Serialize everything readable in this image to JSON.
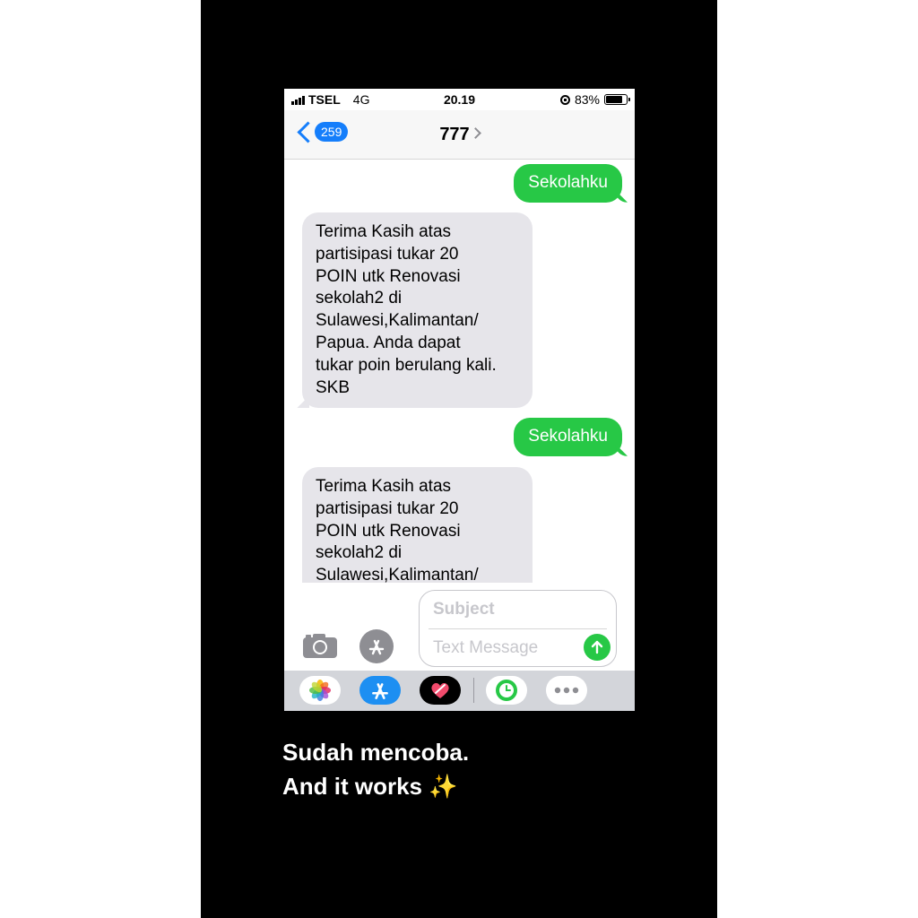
{
  "status_bar": {
    "carrier": "TSEL",
    "network": "4G",
    "time": "20.19",
    "battery": "83%",
    "battery_level": 0.83
  },
  "nav": {
    "back_badge": "259",
    "contact": "777"
  },
  "messages": [
    {
      "direction": "sent",
      "text": "Sekolahku"
    },
    {
      "direction": "received",
      "text": "Terima Kasih atas\npartisipasi tukar 20\nPOIN utk Renovasi\nsekolah2 di\nSulawesi,Kalimantan/\nPapua. Anda dapat\ntukar poin berulang kali.\nSKB"
    },
    {
      "direction": "sent",
      "text": "Sekolahku"
    },
    {
      "direction": "received",
      "text": "Terima Kasih atas\npartisipasi tukar 20\nPOIN utk Renovasi\nsekolah2 di\nSulawesi,Kalimantan/"
    }
  ],
  "compose": {
    "subject_placeholder": "Subject",
    "message_placeholder": "Text Message"
  },
  "app_drawer": [
    "photos-icon",
    "app-store-icon",
    "digital-touch-icon",
    "activity-icon",
    "more-icon"
  ],
  "caption": {
    "line1": "Sudah mencoba.",
    "line2": "And it works",
    "emoji": "✨"
  },
  "colors": {
    "imessage_blue": "#157efb",
    "sms_green": "#27c846",
    "received_bubble": "#e6e5ea"
  }
}
